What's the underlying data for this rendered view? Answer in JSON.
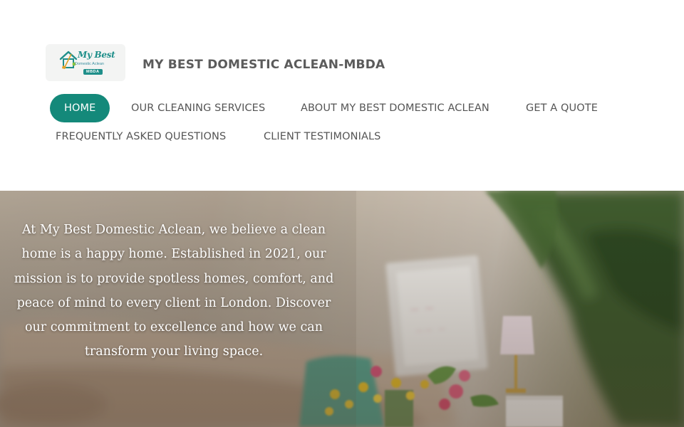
{
  "logo": {
    "line1": "My Best",
    "line2": "Domestic Aclean",
    "badge": "MBDA"
  },
  "site_title": "MY BEST DOMESTIC ACLEAN-MBDA",
  "nav": {
    "items": [
      {
        "label": "HOME",
        "active": true
      },
      {
        "label": "OUR CLEANING SERVICES",
        "active": false
      },
      {
        "label": "ABOUT MY BEST DOMESTIC ACLEAN",
        "active": false
      },
      {
        "label": "GET A QUOTE",
        "active": false
      },
      {
        "label": "FREQUENTLY ASKED QUESTIONS",
        "active": false
      },
      {
        "label": "CLIENT TESTIMONIALS",
        "active": false
      }
    ]
  },
  "hero": {
    "text": "At My Best Domestic Aclean, we believe a clean home is a happy home. Established in 2021, our mission is to provide spotless homes, comfort, and peace of mind to every client in London. Discover our commitment to excellence and how we can transform your living space."
  },
  "colors": {
    "accent": "#14897a",
    "nav_text": "#555555",
    "title_text": "#5b5b5b",
    "hero_text": "#ffffff"
  }
}
